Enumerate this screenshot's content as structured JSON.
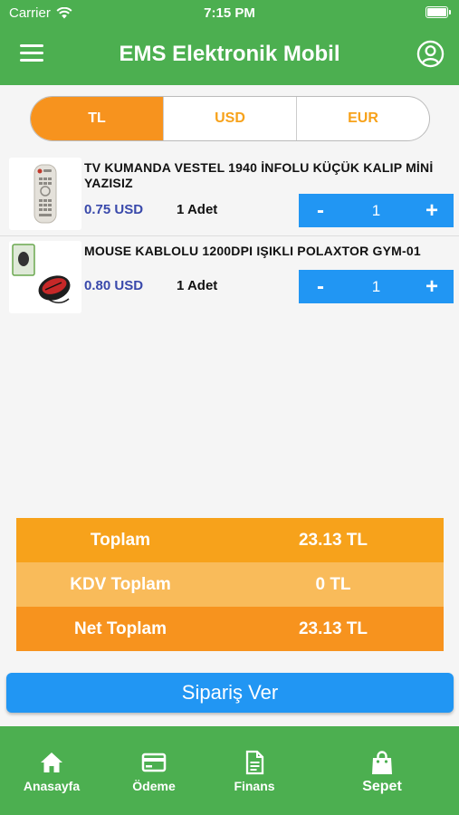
{
  "status_bar": {
    "carrier": "Carrier",
    "time": "7:15 PM"
  },
  "header": {
    "title": "EMS Elektronik Mobil"
  },
  "currency_tabs": [
    {
      "label": "TL",
      "active": true
    },
    {
      "label": "USD",
      "active": false
    },
    {
      "label": "EUR",
      "active": false
    }
  ],
  "cart_items": [
    {
      "name": "TV KUMANDA VESTEL 1940 İNFOLU KÜÇÜK KALIP MİNİ YAZISIZ",
      "price": "0.75 USD",
      "qty_label": "1 Adet",
      "minus": "-",
      "qty": "1",
      "plus": "+"
    },
    {
      "name": "MOUSE KABLOLU 1200DPI IŞIKLI POLAXTOR GYM-01",
      "price": "0.80 USD",
      "qty_label": "1 Adet",
      "minus": "-",
      "qty": "1",
      "plus": "+"
    }
  ],
  "totals": [
    {
      "label": "Toplam",
      "value": "23.13 TL"
    },
    {
      "label": "KDV Toplam",
      "value": "0 TL"
    },
    {
      "label": "Net Toplam",
      "value": "23.13 TL"
    }
  ],
  "order_button": "Sipariş Ver",
  "bottom_nav": [
    {
      "label": "Anasayfa",
      "icon": "home-icon"
    },
    {
      "label": "Ödeme",
      "icon": "card-icon"
    },
    {
      "label": "Finans",
      "icon": "document-icon"
    },
    {
      "label": "Sepet",
      "icon": "bag-icon",
      "active": true
    }
  ],
  "colors": {
    "primary_green": "#4caf50",
    "orange": "#f7931e",
    "blue": "#2196f3",
    "price_blue": "#3949ab"
  }
}
